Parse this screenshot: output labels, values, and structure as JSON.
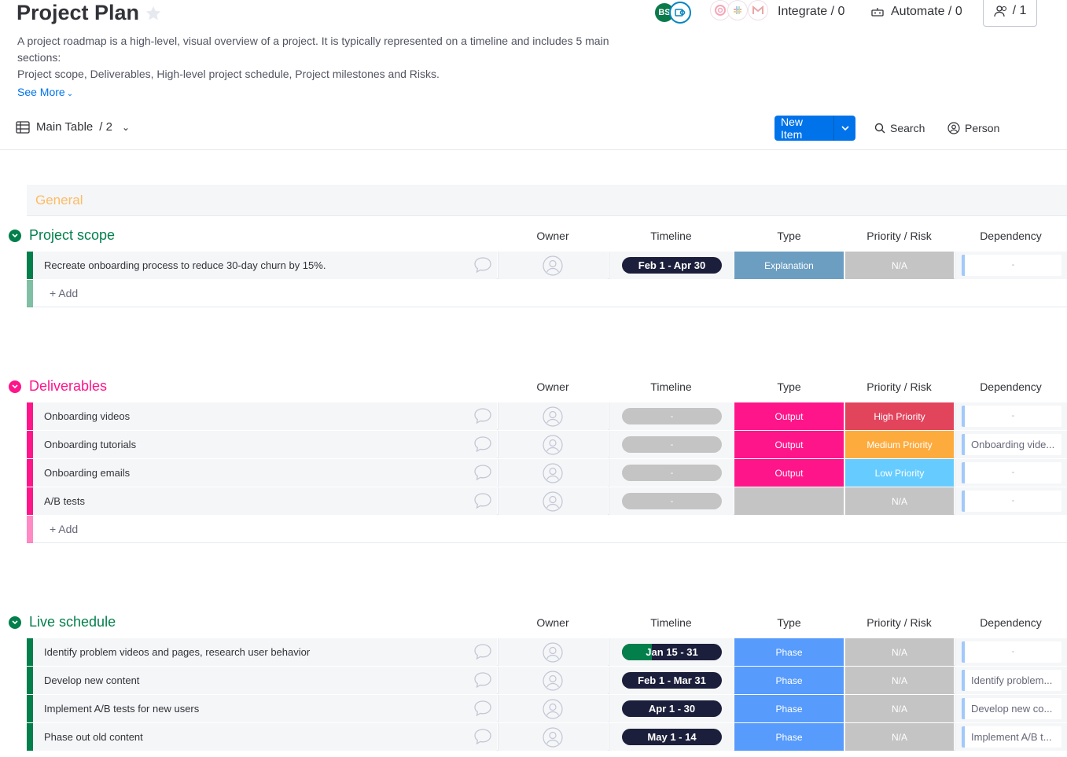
{
  "header": {
    "title": "Project Plan",
    "description_line1": "A project roadmap is a high-level, visual overview of a project. It is typically represented on a timeline and includes 5 main",
    "description_line2": "sections:",
    "description_line3": "Project scope, Deliverables, High-level project schedule, Project milestones and Risks.",
    "see_more": "See More",
    "avatar_initials": "BS",
    "integrate": "Integrate / 0",
    "automate": "Automate / 0",
    "members": "/ 1"
  },
  "toolbar": {
    "view_label": "Main Table",
    "view_count": "/ 2",
    "new_item": "New Item",
    "search": "Search",
    "person": "Person"
  },
  "general_label": "General",
  "columns": {
    "owner": "Owner",
    "timeline": "Timeline",
    "type": "Type",
    "priority": "Priority / Risk",
    "dependency": "Dependency"
  },
  "add_label": "+ Add",
  "colors": {
    "green": "#037f4c",
    "pink": "#ff158a",
    "blue": "#579bfc",
    "steel": "#6b9ec1",
    "gray": "#c4c4c4",
    "orange": "#fdab3d",
    "light_blue": "#66ccff",
    "red": "#e2445c"
  },
  "groups": [
    {
      "title": "Project scope",
      "color": "#037f4c",
      "rows": [
        {
          "name": "Recreate onboarding process to reduce 30-day churn by 15%.",
          "timeline": "Feb 1 - Apr 30",
          "timeline_progress": 0,
          "type": "Explanation",
          "type_color": "#6b9ec1",
          "priority": "N/A",
          "priority_color": "#c4c4c4",
          "dependency": "-"
        }
      ]
    },
    {
      "title": "Deliverables",
      "color": "#ff158a",
      "rows": [
        {
          "name": "Onboarding videos",
          "timeline": "-",
          "timeline_progress": 0,
          "type": "Output",
          "type_color": "#ff158a",
          "priority": "High Priority",
          "priority_color": "#e2445c",
          "dependency": "-"
        },
        {
          "name": "Onboarding tutorials",
          "timeline": "-",
          "timeline_progress": 0,
          "type": "Output",
          "type_color": "#ff158a",
          "priority": "Medium Priority",
          "priority_color": "#fdab3d",
          "dependency": "Onboarding vide..."
        },
        {
          "name": "Onboarding emails",
          "timeline": "-",
          "timeline_progress": 0,
          "type": "Output",
          "type_color": "#ff158a",
          "priority": "Low Priority",
          "priority_color": "#66ccff",
          "dependency": "-"
        },
        {
          "name": "A/B tests",
          "timeline": "-",
          "timeline_progress": 0,
          "type": "",
          "type_color": "#c4c4c4",
          "priority": "N/A",
          "priority_color": "#c4c4c4",
          "dependency": "-"
        }
      ]
    },
    {
      "title": "Live schedule",
      "color": "#037f4c",
      "rows": [
        {
          "name": "Identify problem videos and pages, research user behavior",
          "timeline": "Jan 15 - 31",
          "timeline_progress": 0.3,
          "type": "Phase",
          "type_color": "#579bfc",
          "priority": "N/A",
          "priority_color": "#c4c4c4",
          "dependency": "-"
        },
        {
          "name": "Develop new content",
          "timeline": "Feb 1 - Mar 31",
          "timeline_progress": 0,
          "type": "Phase",
          "type_color": "#579bfc",
          "priority": "N/A",
          "priority_color": "#c4c4c4",
          "dependency": "Identify problem..."
        },
        {
          "name": "Implement A/B tests for new users",
          "timeline": "Apr 1 - 30",
          "timeline_progress": 0,
          "type": "Phase",
          "type_color": "#579bfc",
          "priority": "N/A",
          "priority_color": "#c4c4c4",
          "dependency": "Develop new co..."
        },
        {
          "name": "Phase out old content",
          "timeline": "May 1 - 14",
          "timeline_progress": 0,
          "type": "Phase",
          "type_color": "#579bfc",
          "priority": "N/A",
          "priority_color": "#c4c4c4",
          "dependency": "Implement A/B t..."
        }
      ]
    }
  ]
}
